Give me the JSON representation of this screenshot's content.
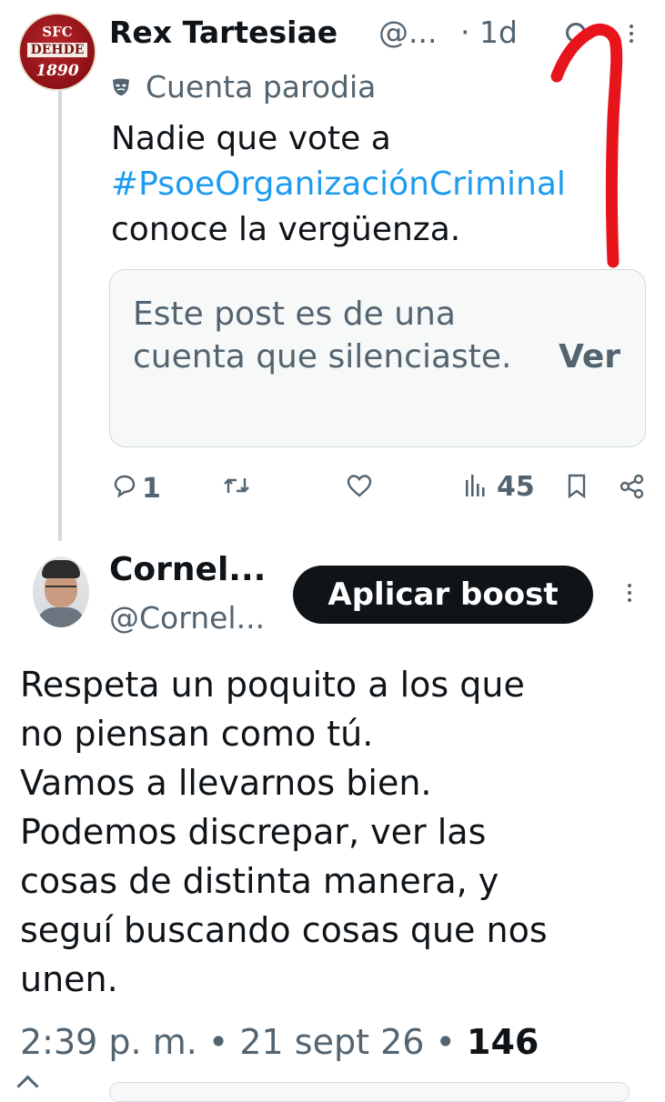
{
  "colors": {
    "text_primary": "#0f1419",
    "text_secondary": "#536471",
    "link": "#1d9bf0",
    "annotation_red": "#e8141c",
    "boost_bg": "#0f1419"
  },
  "parent_post": {
    "avatar_lines": [
      "SFC",
      "DEHDE",
      "1890"
    ],
    "display_name": "Rex Tartesiae",
    "handle": "@...",
    "time": "· 1d",
    "parody_label": "Cuenta parodia",
    "text_before": "Nadie que vote a",
    "hashtag": "#PsoeOrganizaciónCriminal",
    "text_after": "conoce la vergüenza.",
    "muted_notice": "Este post es de una cuenta que silenciaste.",
    "muted_action": "Ver",
    "actions": {
      "replies": "1",
      "views": "45"
    },
    "icons": [
      "grok-icon",
      "more-icon",
      "parody-mask-icon",
      "reply-icon",
      "retweet-icon",
      "like-icon",
      "views-icon",
      "bookmark-icon",
      "share-icon"
    ]
  },
  "main_post": {
    "display_name": "Cornel...",
    "handle": "@Cornel...",
    "boost_button": "Aplicar boost",
    "text": "Respeta un poquito a los que\nno piensan como tú.\nVamos a llevarnos bien.\nPodemos discrepar, ver las\ncosas de distinta manera, y\nseguí buscando cosas que nos\nunen.",
    "timestamp": "2:39 p. m. • 21 sept 26 • ",
    "views_count": "146"
  }
}
